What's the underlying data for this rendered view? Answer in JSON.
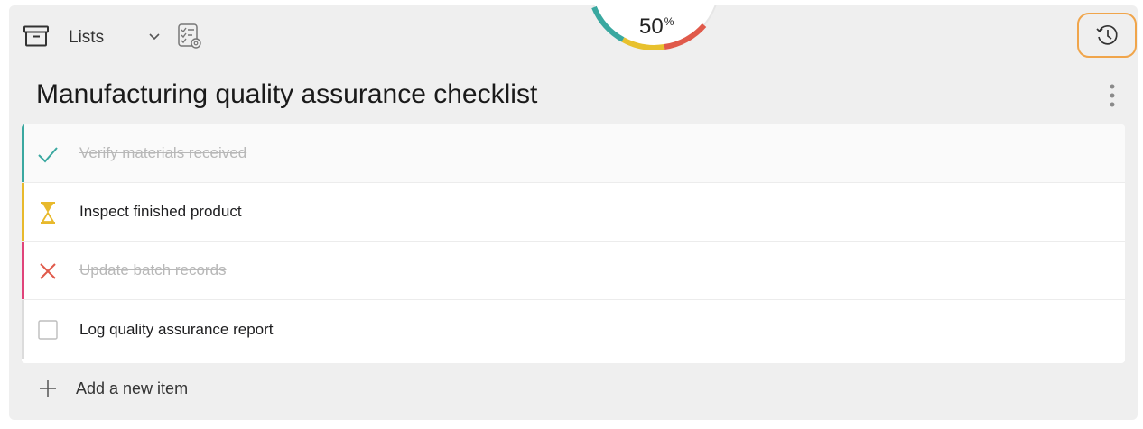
{
  "header": {
    "lists_label": "Lists",
    "progress": {
      "value": 50,
      "label": "50",
      "unit": "%"
    }
  },
  "title": "Manufacturing quality assurance checklist",
  "items": [
    {
      "label": "Verify materials received",
      "status": "done",
      "color": "#3aa8a0"
    },
    {
      "label": "Inspect finished product",
      "status": "in-progress",
      "color": "#e8b92c"
    },
    {
      "label": "Update batch records",
      "status": "failed",
      "color": "#e05a4b"
    },
    {
      "label": "Log quality assurance report",
      "status": "todo",
      "color": "#cccccc"
    }
  ],
  "add_item_label": "Add a new item",
  "colors": {
    "accent_highlight": "#f0a54b",
    "done": "#3aa8a0",
    "in_progress": "#e8b92c",
    "failed": "#e05a4b",
    "failed_bar": "#e0447a"
  },
  "icons": {
    "archive": "archive-box-icon",
    "chevron": "chevron-down-icon",
    "list_settings": "checklist-settings-icon",
    "history": "history-clock-icon",
    "more": "more-vertical-icon",
    "add": "plus-icon"
  }
}
